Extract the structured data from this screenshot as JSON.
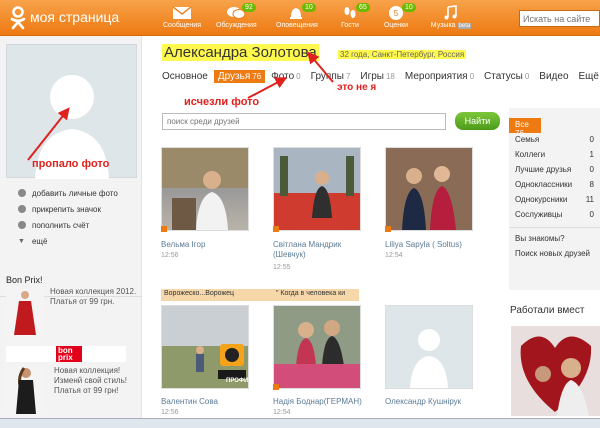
{
  "header": {
    "site_title": "моя страница",
    "search_placeholder": "Искать на сайте",
    "nav": [
      {
        "label": "Сообщения",
        "icon": "envelope-icon",
        "badge": ""
      },
      {
        "label": "Обсуждения",
        "icon": "chat-bubbles-icon",
        "badge": "92"
      },
      {
        "label": "Оповещения",
        "icon": "bell-icon",
        "badge": "10"
      },
      {
        "label": "Гости",
        "icon": "footprints-icon",
        "badge": "65"
      },
      {
        "label": "Оценки",
        "icon": "rating-icon",
        "badge": "10"
      },
      {
        "label": "Музыка",
        "icon": "music-note-icon",
        "badge": "beta"
      }
    ]
  },
  "profile": {
    "name": "Александра Золотова",
    "meta": "32 года, Санкт-Петербург, Россия"
  },
  "tabs": [
    {
      "label": "Основное",
      "count": ""
    },
    {
      "label": "Друзья",
      "count": "76"
    },
    {
      "label": "Фото",
      "count": "0"
    },
    {
      "label": "Группы",
      "count": "7"
    },
    {
      "label": "Игры",
      "count": "18"
    },
    {
      "label": "Мероприятия",
      "count": "0"
    },
    {
      "label": "Статусы",
      "count": "0"
    },
    {
      "label": "Видео",
      "count": ""
    },
    {
      "label": "Ещё",
      "count": "▾"
    }
  ],
  "friend_search": {
    "placeholder": "поиск среди друзей",
    "button": "Найти"
  },
  "annotations": {
    "photo_missing": "пропало фото",
    "photos_gone": "исчезли фото",
    "not_me": "это не я"
  },
  "side_menu": [
    {
      "label": "добавить личные фото",
      "icon": "camera-icon"
    },
    {
      "label": "прикрепить значок",
      "icon": "pin-icon"
    },
    {
      "label": "пополнить счёт",
      "icon": "coin-icon"
    },
    {
      "label": "ещё",
      "icon": "chevron-down-icon"
    }
  ],
  "ads": {
    "title": "Bon Prix!",
    "item1": "Новая коллекция 2012. Платья от 99 грн.",
    "logo": "bon prix",
    "item2": "Новая коллекция! Изменй свой стиль! Платья от 99 грн!"
  },
  "friends": [
    {
      "name": "Вельма Ігор",
      "time": "12:56",
      "tag": ""
    },
    {
      "name": "Світлана Мандрик (Шевчук)",
      "time": "12:55",
      "tag": ""
    },
    {
      "name": "Liliya Sapyla ( Soltus)",
      "time": "12:54",
      "tag": ""
    },
    {
      "name": "Валентин Сова",
      "time": "12:56",
      "tag": "Ворожеско...Ворожец"
    },
    {
      "name": "Надія Боднар(ГЕРМАН)",
      "time": "12:54",
      "tag": "\" Когда в человека ки"
    },
    {
      "name": "Олександр Кушнірук",
      "time": "",
      "tag": ""
    }
  ],
  "profi_badge": "ПРОФИ",
  "filters": [
    {
      "label": "Все",
      "count": "76"
    },
    {
      "label": "Семья",
      "count": "0"
    },
    {
      "label": "Коллеги",
      "count": "1"
    },
    {
      "label": "Лучшие друзья",
      "count": "0"
    },
    {
      "label": "Одноклассники",
      "count": "8"
    },
    {
      "label": "Однокурсники",
      "count": "11"
    },
    {
      "label": "Сослуживцы",
      "count": "0"
    }
  ],
  "right_links": [
    "Вы знакомы?",
    "Поиск новых друзей"
  ],
  "work_title": "Работали вмест",
  "colors": {
    "brand": "#ee7a12",
    "accent_green": "#6fb800",
    "highlight": "#fff84d",
    "annotation": "#e0221f"
  }
}
